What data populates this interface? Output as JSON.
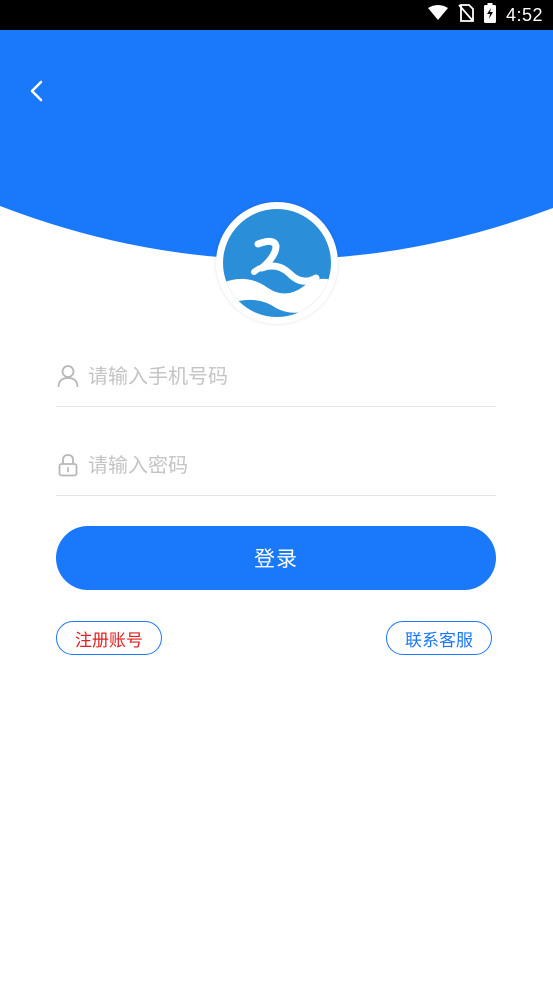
{
  "status_bar": {
    "time": "4:52"
  },
  "header": {
    "back_icon": "chevron-left-icon",
    "accent_color": "#1a78fa"
  },
  "logo": {
    "icon": "app-logo",
    "colors": {
      "primary": "#2a8fd8",
      "background": "#ffffff"
    }
  },
  "form": {
    "phone": {
      "icon": "user-icon",
      "value": "",
      "placeholder": "请输入手机号码"
    },
    "password": {
      "icon": "lock-icon",
      "value": "",
      "placeholder": "请输入密码"
    },
    "login_label": "登录"
  },
  "links": {
    "register_label": "注册账号",
    "register_color": "#e02020",
    "service_label": "联系客服"
  }
}
